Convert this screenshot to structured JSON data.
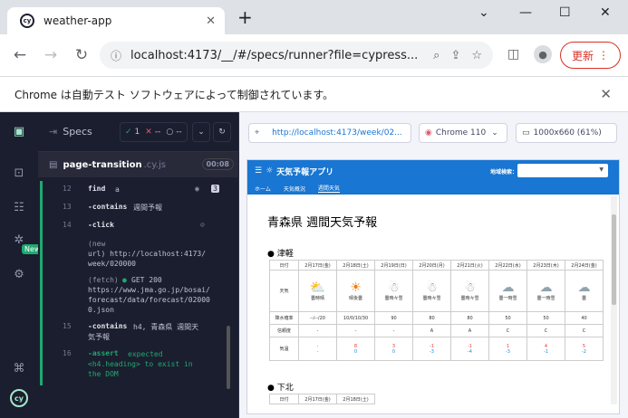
{
  "browser": {
    "tab_title": "weather-app",
    "favicon_text": "cy",
    "url": "localhost:4173/__/#/specs/runner?file=cypress...",
    "update_button": "更新",
    "infobar_text": "Chrome は自動テスト ソフトウェアによって制御されています。"
  },
  "reporter": {
    "specs_label": "Specs",
    "passed": "1",
    "failed": "--",
    "pending": "--",
    "spec_name": "page-transition",
    "spec_ext": ".cy.js",
    "duration": "00:08",
    "new_badge": "New",
    "commands": [
      {
        "num": "12",
        "name": "find",
        "arg": "a",
        "badge": "3"
      },
      {
        "num": "13",
        "name": "-contains",
        "arg": "週間予報"
      },
      {
        "num": "14",
        "name": "-click",
        "arg": ""
      },
      {
        "msg1": "(new",
        "msg2": "url)  http://localhost:4173/",
        "msg3": "week/020000"
      },
      {
        "msg1": "(fetch)",
        "method": "GET 200",
        "msg2": "https://www.jma.go.jp/bosai/",
        "msg3": "forecast/data/forecast/02000",
        "msg4": "0.json"
      },
      {
        "num": "15",
        "name": "-contains",
        "arg": "h4, 青森県 週間天",
        "arg2": "気予報"
      },
      {
        "num": "16",
        "name": "-assert",
        "line1": "expected",
        "line2": "<h4.heading> to exist in",
        "line3": "the DOM"
      }
    ]
  },
  "aut": {
    "url": "http://localhost:4173/week/02...",
    "browser_name": "Chrome 110",
    "viewport_size": "1000x660 (61%)"
  },
  "app": {
    "title": "天気予報アプリ",
    "nav": [
      "ホーム",
      "天気概況",
      "週間天気"
    ],
    "search_label": "地域検索：",
    "heading": "青森県 週間天気予報",
    "regions": [
      "● 津軽",
      "● 下北"
    ],
    "row_labels": [
      "日付",
      "天気",
      "降水確率",
      "信頼度",
      "気温"
    ],
    "dates": [
      "2月17日(金)",
      "2月18日(土)",
      "2月19日(日)",
      "2月20日(月)",
      "2月21日(火)",
      "2月22日(水)",
      "2月23日(木)",
      "2月24日(金)"
    ],
    "weather": [
      "曇時晴",
      "晴後曇",
      "曇時々雪",
      "曇時々雪",
      "曇時々雪",
      "曇一時雪",
      "曇一時雪",
      "曇"
    ],
    "pop": [
      "--/--/20",
      "10/0/10/30",
      "90",
      "80",
      "80",
      "50",
      "50",
      "40"
    ],
    "reliability": [
      "-",
      "-",
      "-",
      "A",
      "A",
      "C",
      "C",
      "C"
    ],
    "temp_max": [
      "-",
      "8",
      "3",
      "-1",
      "-1",
      "1",
      "4",
      "5"
    ],
    "temp_min": [
      "-",
      "0",
      "0",
      "-3",
      "-4",
      "-3",
      "-1",
      "-2"
    ],
    "dates2": [
      "2月17日(金)",
      "2月18日(土)"
    ]
  }
}
